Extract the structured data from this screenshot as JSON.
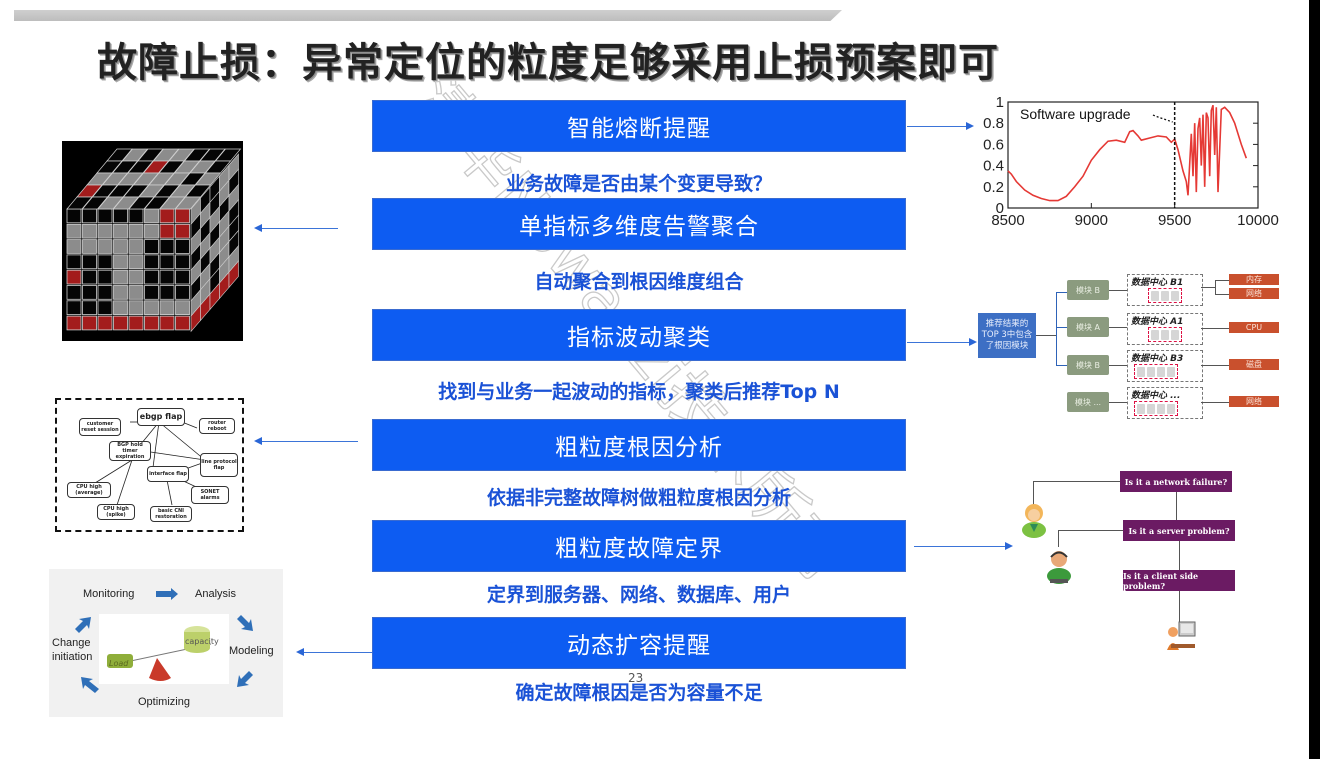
{
  "slide": {
    "title": "故障止损：异常定位的粒度足够采用止损预案即可",
    "page_number": "23",
    "watermark": "清华Nowanzi技术所有"
  },
  "steps": [
    {
      "label": "智能熔断提醒",
      "caption": "业务故障是否由某个变更导致？"
    },
    {
      "label": "单指标多维度告警聚合",
      "caption": "自动聚合到根因维度组合"
    },
    {
      "label": "指标波动聚类",
      "caption": "找到与业务一起波动的指标，聚类后推荐Top N"
    },
    {
      "label": "粗粒度根因分析",
      "caption": "依据非完整故障树做粗粒度根因分析"
    },
    {
      "label": "粗粒度故障定界",
      "caption": "定界到服务器、网络、数据库、用户"
    },
    {
      "label": "动态扩容提醒",
      "caption": "确定故障根因是否为容量不足"
    }
  ],
  "colors": {
    "step_box": "#0d5cf2",
    "caption_text": "#1a52d6",
    "arrow": "#2a66d6",
    "chart_line": "#e53935",
    "result_box": "#c9502d",
    "question_box": "#6b1b63"
  },
  "chart_data": {
    "type": "line",
    "title": "",
    "annotation": "Software upgrade",
    "annotation_x": 9500,
    "xlabel": "",
    "ylabel": "",
    "xlim": [
      8500,
      10000
    ],
    "ylim": [
      0,
      1
    ],
    "x_ticks": [
      "8500",
      "9000",
      "9500",
      "10000"
    ],
    "y_ticks": [
      "0",
      "0.2",
      "0.4",
      "0.6",
      "0.8",
      "1"
    ],
    "series": [
      {
        "name": "metric",
        "x": [
          8500,
          8520,
          8550,
          8600,
          8650,
          8700,
          8750,
          8800,
          8850,
          8900,
          8950,
          9000,
          9050,
          9100,
          9150,
          9200,
          9230,
          9250,
          9280,
          9300,
          9350,
          9400,
          9450,
          9480,
          9500,
          9520,
          9550,
          9570,
          9580,
          9600,
          9610,
          9620,
          9630,
          9640,
          9650,
          9660,
          9670,
          9680,
          9690,
          9700,
          9710,
          9720,
          9730,
          9740,
          9750,
          9760,
          9780,
          9800,
          9830,
          9860,
          9900,
          9930
        ],
        "values": [
          0.35,
          0.32,
          0.25,
          0.17,
          0.12,
          0.09,
          0.07,
          0.07,
          0.11,
          0.2,
          0.3,
          0.45,
          0.55,
          0.63,
          0.64,
          0.62,
          0.72,
          0.73,
          0.68,
          0.64,
          0.66,
          0.68,
          0.67,
          0.62,
          0.65,
          0.55,
          0.35,
          0.25,
          0.12,
          0.7,
          0.3,
          0.8,
          0.15,
          0.75,
          0.85,
          0.4,
          0.88,
          0.2,
          0.9,
          0.85,
          0.3,
          0.92,
          0.97,
          0.5,
          0.95,
          0.15,
          0.93,
          0.95,
          0.9,
          0.8,
          0.6,
          0.47
        ]
      }
    ],
    "grid": false,
    "legend": "none"
  },
  "cluster_diagram": {
    "recommendation": "推荐结果的TOP 3中包含了根因模块",
    "rows": [
      {
        "module": "模块 B",
        "datacenter": "数据中心 B1",
        "results": [
          "内存",
          "网络"
        ]
      },
      {
        "module": "模块 A",
        "datacenter": "数据中心 A1",
        "results": [
          "CPU"
        ]
      },
      {
        "module": "模块 B",
        "datacenter": "数据中心 B3",
        "results": [
          "磁盘"
        ]
      },
      {
        "module": "模块 ...",
        "datacenter": "数据中心 ...",
        "results": [
          "网络"
        ]
      }
    ]
  },
  "fault_tree": {
    "nodes": [
      "ebgp flap",
      "customer reset session",
      "router reboot",
      "BGP hold timer expiration",
      "line protocol flap",
      "interface flap",
      "CPU high (average)",
      "SONET alarms",
      "CPU high (spike)",
      "basic CNI restoration"
    ]
  },
  "flow_diagram": {
    "questions": [
      "Is it a network failure?",
      "Is it a server problem?",
      "Is it a client side problem?"
    ]
  },
  "capacity_cycle": {
    "stages": [
      "Monitoring",
      "Analysis",
      "Modeling",
      "Optimizing",
      "Change initiation"
    ],
    "balance_labels": [
      "Load",
      "capacity"
    ]
  }
}
